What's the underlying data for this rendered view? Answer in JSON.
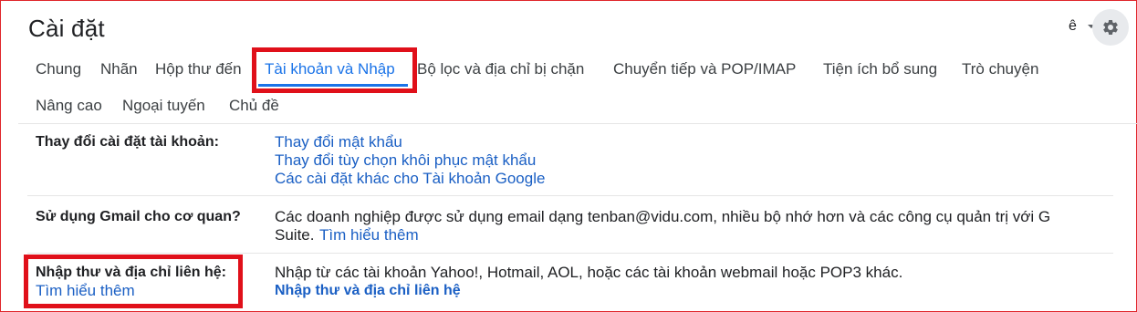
{
  "page_title": "Cài đặt",
  "toolbar": {
    "language_label": "ê"
  },
  "tabs": [
    {
      "label": "Chung"
    },
    {
      "label": "Nhãn"
    },
    {
      "label": "Hộp thư đến"
    },
    {
      "label": "Tài khoản và Nhập",
      "active": true
    },
    {
      "label": "Bộ lọc và địa chỉ bị chặn"
    },
    {
      "label": "Chuyển tiếp và POP/IMAP"
    },
    {
      "label": "Tiện ích bổ sung"
    },
    {
      "label": "Trò chuyện"
    },
    {
      "label": "Nâng cao"
    },
    {
      "label": "Ngoại tuyến"
    },
    {
      "label": "Chủ đề"
    }
  ],
  "rows": {
    "change_account": {
      "label": "Thay đổi cài đặt tài khoản:",
      "links": [
        "Thay đổi mật khẩu",
        "Thay đổi tùy chọn khôi phục mật khẩu",
        "Các cài đặt khác cho Tài khoản Google"
      ]
    },
    "work_use": {
      "label": "Sử dụng Gmail cho cơ quan?",
      "text_line1": "Các doanh nghiệp được sử dụng email dạng tenban@vidu.com, nhiều bộ nhớ hơn và các công cụ quản trị với G",
      "text_line2": "Suite.",
      "learn_more": "Tìm hiểu thêm"
    },
    "import": {
      "label": "Nhập thư và địa chỉ liên hệ:",
      "learn_more": "Tìm hiểu thêm",
      "text": "Nhập từ các tài khoản Yahoo!, Hotmail, AOL, hoặc các tài khoản webmail hoặc POP3 khác.",
      "action_link": "Nhập thư và địa chỉ liên hệ"
    }
  },
  "colors": {
    "highlight_box": "#e0101a",
    "link": "#1a5fc4",
    "active_tab": "#1a73e8"
  },
  "icons": {
    "settings": "gear-icon",
    "dropdown": "caret-down-icon"
  }
}
